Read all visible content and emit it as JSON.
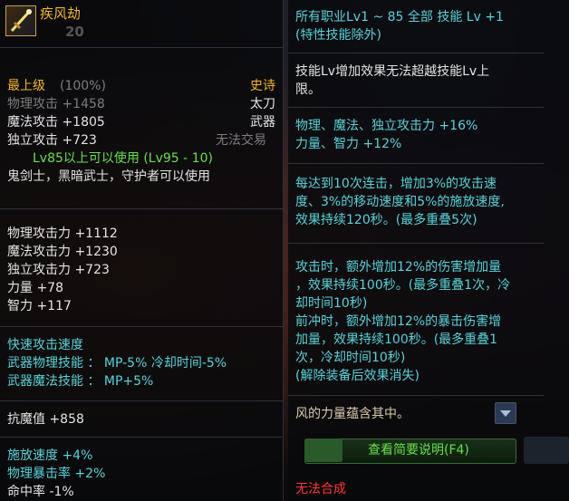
{
  "item": {
    "name": "疾风劫",
    "level": "20"
  },
  "left": {
    "grade": "最上级",
    "grade_pct": "(100%)",
    "rarity": "史诗",
    "phys_atk": "物理攻击 +1458",
    "weapon_type": "太刀",
    "mag_atk": "魔法攻击 +1805",
    "category": "武器",
    "ind_atk": "独立攻击 +723",
    "trade": "无法交易",
    "usable_level": "Lv85以上可以使用 (Lv95 - 10)",
    "classes": "鬼剑士，黑暗武士，守护者可以使用",
    "stats": [
      "物理攻击力 +1112",
      "魔法攻击力 +1230",
      "独立攻击力 +723",
      "力量 +78",
      "智力 +117"
    ],
    "speed_title": "快速攻击速度",
    "skill_phys": "武器物理技能 ： MP-5% 冷却时间-5%",
    "skill_mag": "武器魔法技能 ： MP+5%",
    "resist": "抗魔值 +858",
    "cast_speed": "施放速度 +4%",
    "crit": "物理暴击率 +2%",
    "hit": "命中率 -1%"
  },
  "right": {
    "line1": "所有职业Lv1 ~ 85 全部 技能 Lv +1",
    "line2": "(特性技能除外)",
    "line3": "技能Lv增加效果无法超越技能Lv上",
    "line4": "限。",
    "line5": "物理、魔法、独立攻击力 +16%",
    "line6": "力量、智力 +12%",
    "line7": "每达到10次连击，增加3%的攻击速",
    "line8": "度、3%的移动速度和5%的施放速度,",
    "line9": "效果持续120秒。(最多重叠5次)",
    "line10": "攻击时，额外增加12%的伤害增加量",
    "line11": "，效果持续100秒。(最多重叠1次，冷",
    "line12": "却时间10秒)",
    "line13": "前冲时，额外增加12%的暴击伤害增",
    "line14": "加量，效果持续100秒。(最多重叠1",
    "line15": "次，冷却时间10秒)",
    "line16": "(解除装备后效果消失)",
    "flavor": "风的力量蕴含其中。",
    "summary_btn": "查看简要说明(F4)",
    "no_synth": "无法合成"
  },
  "colors": {
    "gold": "#f2b81a",
    "green": "#67e04a",
    "cyan": "#56d4da",
    "red": "#ff3636"
  }
}
